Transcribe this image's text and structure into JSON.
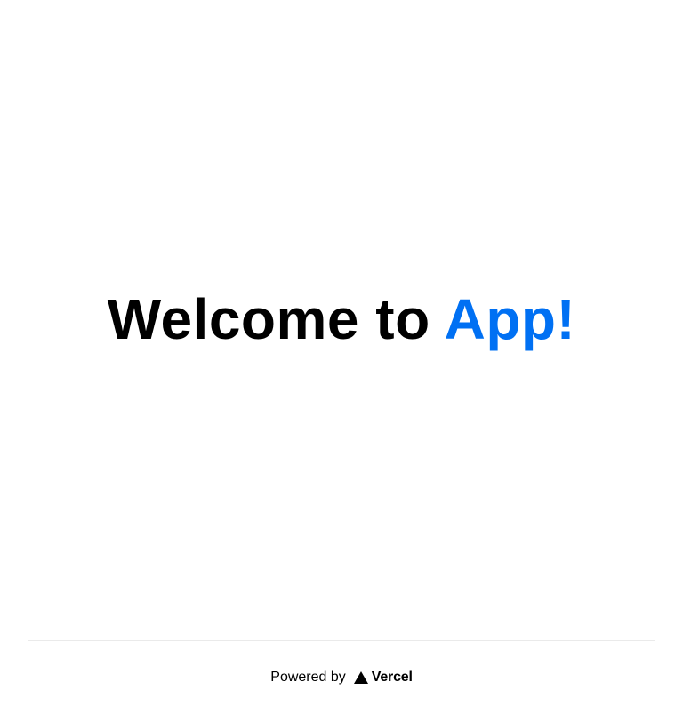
{
  "main": {
    "title_prefix": "Welcome to",
    "title_accent": "App!"
  },
  "footer": {
    "powered_label": "Powered by",
    "brand": "Vercel",
    "brand_icon": "vercel-triangle-icon"
  },
  "colors": {
    "accent": "#0070f3",
    "text": "#000000",
    "divider": "#eaeaea",
    "background": "#ffffff"
  }
}
